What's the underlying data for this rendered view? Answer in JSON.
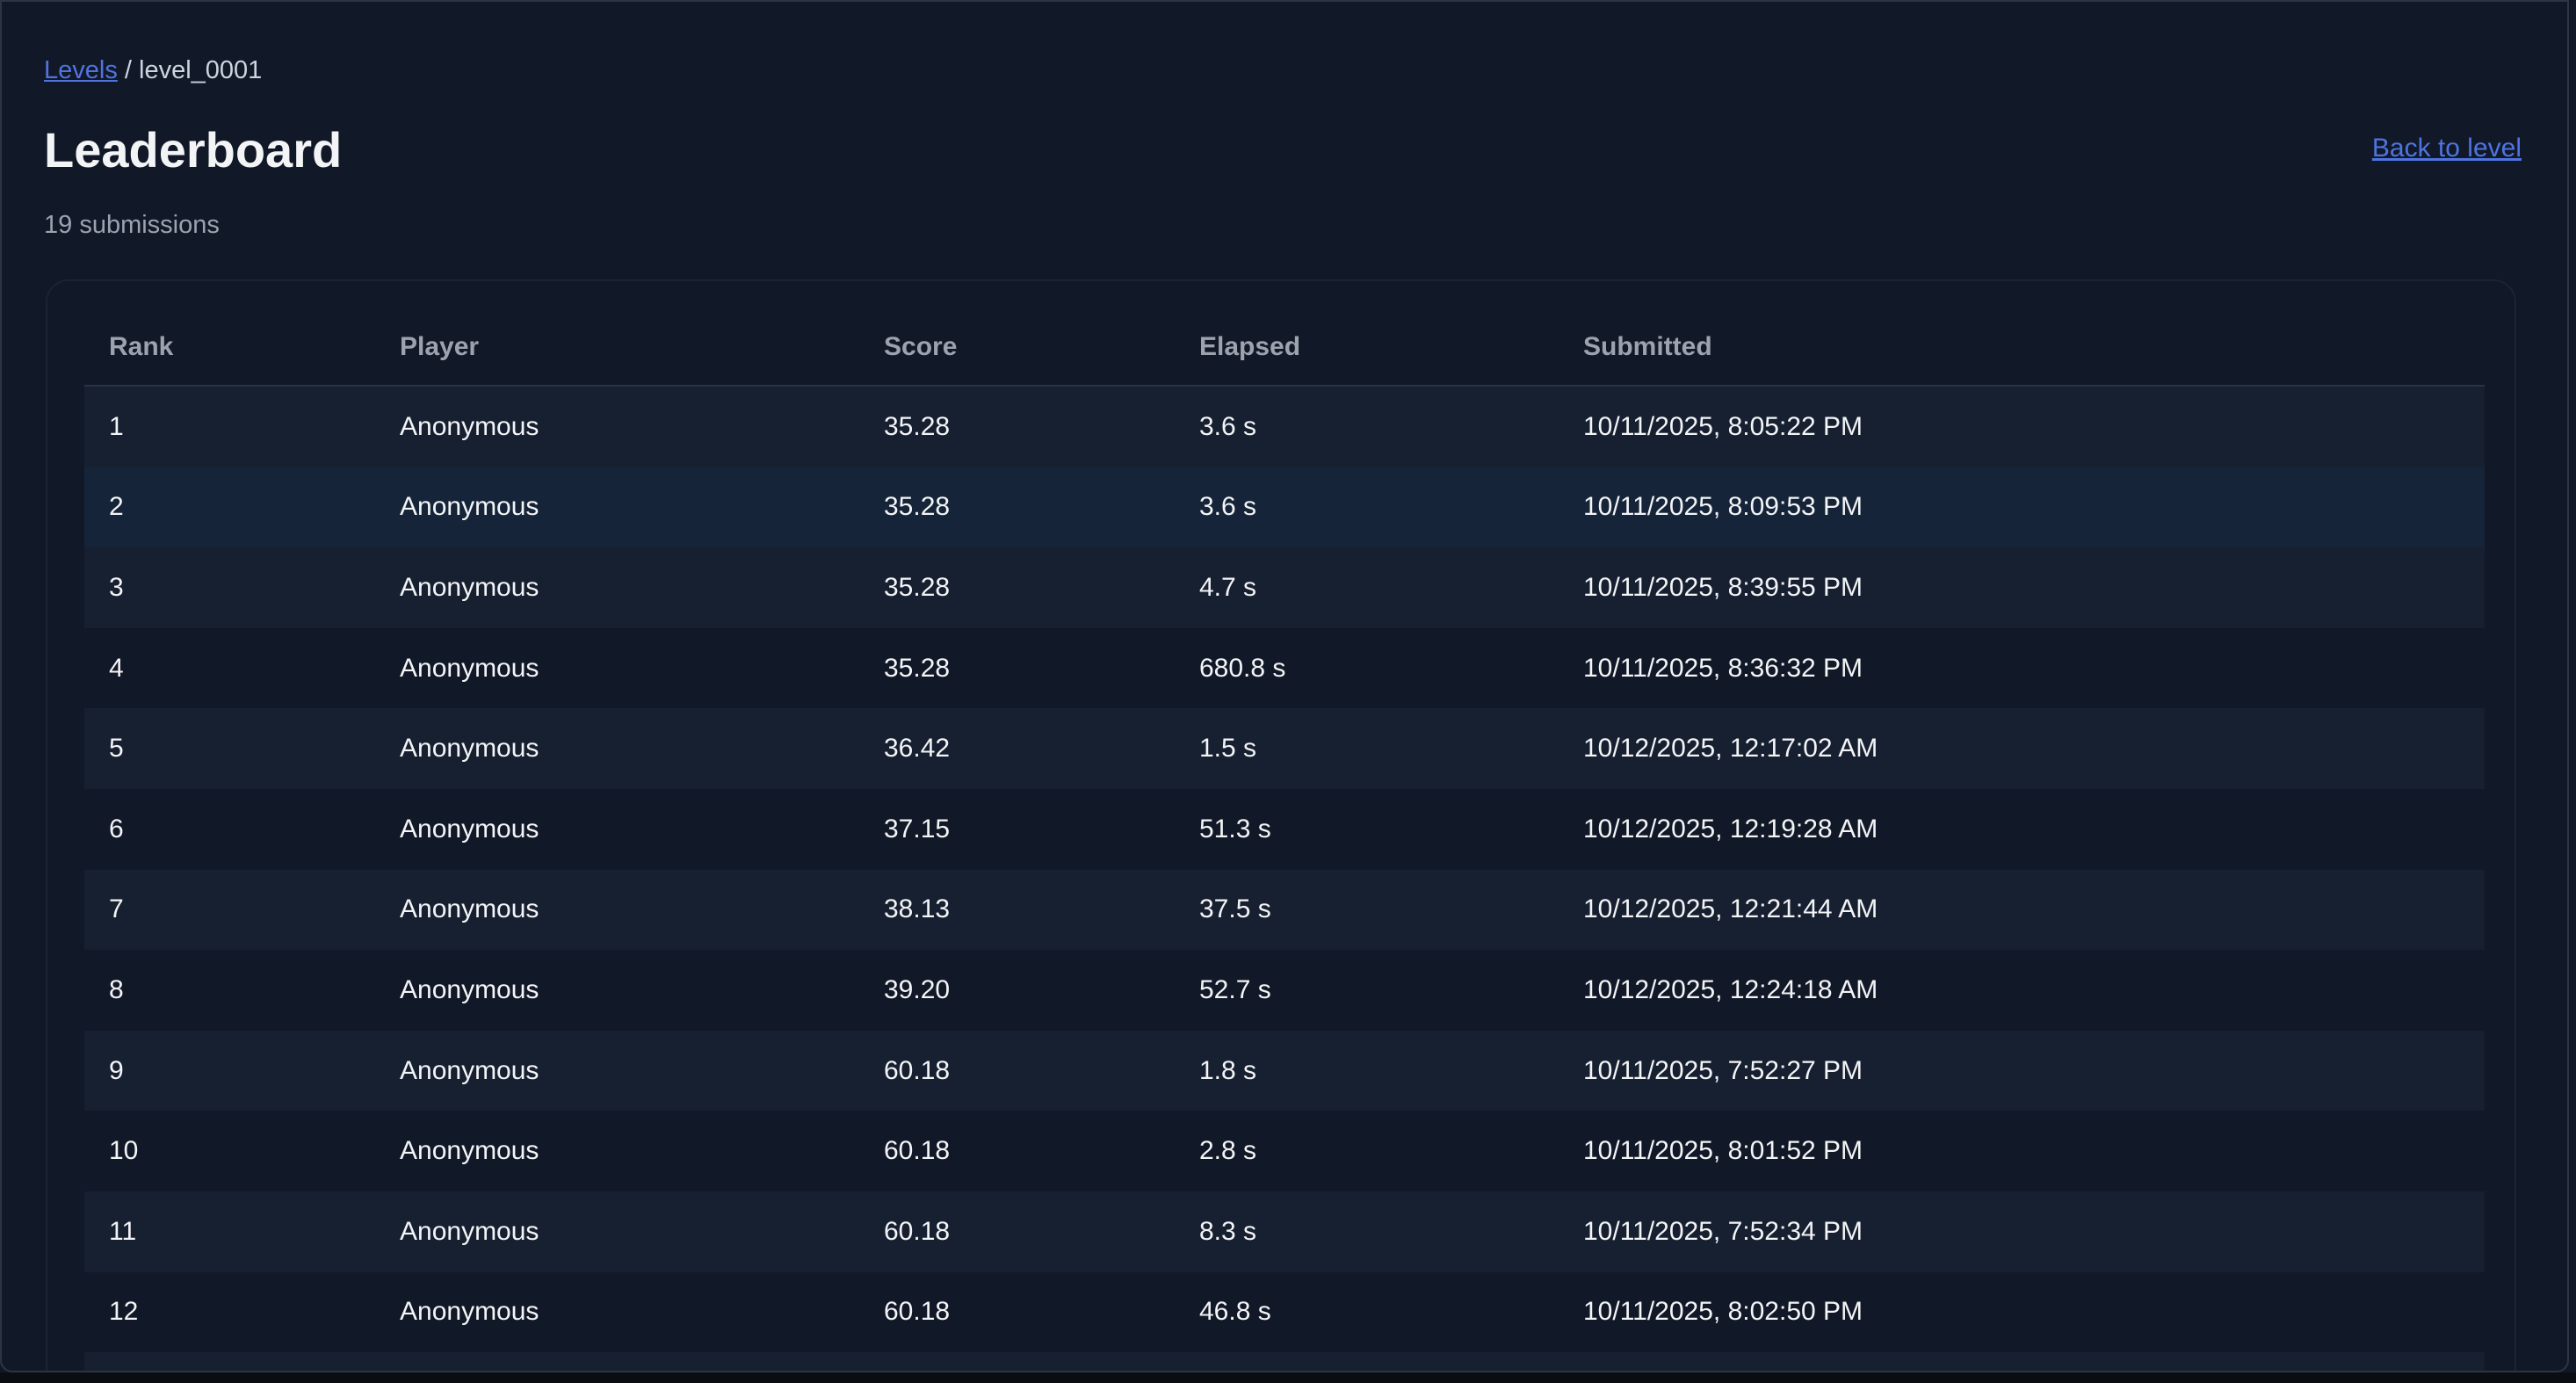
{
  "breadcrumb": {
    "levels_link": "Levels",
    "separator": "/",
    "current": "level_0001"
  },
  "header": {
    "title": "Leaderboard",
    "back_link": "Back to level",
    "submission_count": "19 submissions"
  },
  "table": {
    "columns": [
      "Rank",
      "Player",
      "Score",
      "Elapsed",
      "Submitted"
    ],
    "rows": [
      {
        "rank": "1",
        "player": "Anonymous",
        "score": "35.28",
        "elapsed": "3.6 s",
        "submitted": "10/11/2025, 8:05:22 PM"
      },
      {
        "rank": "2",
        "player": "Anonymous",
        "score": "35.28",
        "elapsed": "3.6 s",
        "submitted": "10/11/2025, 8:09:53 PM"
      },
      {
        "rank": "3",
        "player": "Anonymous",
        "score": "35.28",
        "elapsed": "4.7 s",
        "submitted": "10/11/2025, 8:39:55 PM"
      },
      {
        "rank": "4",
        "player": "Anonymous",
        "score": "35.28",
        "elapsed": "680.8 s",
        "submitted": "10/11/2025, 8:36:32 PM"
      },
      {
        "rank": "5",
        "player": "Anonymous",
        "score": "36.42",
        "elapsed": "1.5 s",
        "submitted": "10/12/2025, 12:17:02 AM"
      },
      {
        "rank": "6",
        "player": "Anonymous",
        "score": "37.15",
        "elapsed": "51.3 s",
        "submitted": "10/12/2025, 12:19:28 AM"
      },
      {
        "rank": "7",
        "player": "Anonymous",
        "score": "38.13",
        "elapsed": "37.5 s",
        "submitted": "10/12/2025, 12:21:44 AM"
      },
      {
        "rank": "8",
        "player": "Anonymous",
        "score": "39.20",
        "elapsed": "52.7 s",
        "submitted": "10/12/2025, 12:24:18 AM"
      },
      {
        "rank": "9",
        "player": "Anonymous",
        "score": "60.18",
        "elapsed": "1.8 s",
        "submitted": "10/11/2025, 7:52:27 PM"
      },
      {
        "rank": "10",
        "player": "Anonymous",
        "score": "60.18",
        "elapsed": "2.8 s",
        "submitted": "10/11/2025, 8:01:52 PM"
      },
      {
        "rank": "11",
        "player": "Anonymous",
        "score": "60.18",
        "elapsed": "8.3 s",
        "submitted": "10/11/2025, 7:52:34 PM"
      },
      {
        "rank": "12",
        "player": "Anonymous",
        "score": "60.18",
        "elapsed": "46.8 s",
        "submitted": "10/11/2025, 8:02:50 PM"
      }
    ]
  },
  "colors": {
    "background": "#111827",
    "link": "#4f74e0",
    "row_striped": "#172031",
    "row_hover": "#152438"
  }
}
